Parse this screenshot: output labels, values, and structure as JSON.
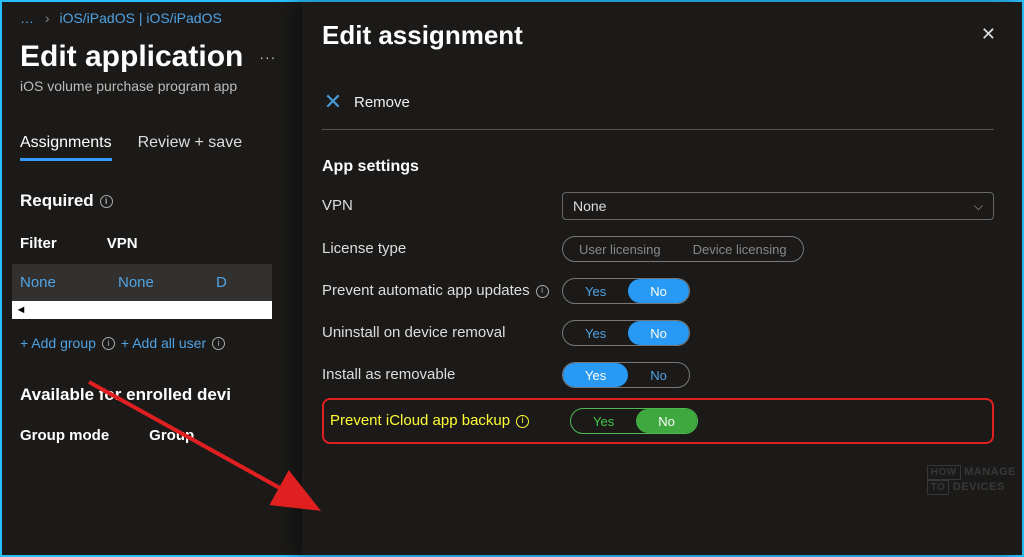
{
  "breadcrumb": {
    "dots": "…",
    "segment": "iOS/iPadOS | iOS/iPadOS"
  },
  "page": {
    "title": "Edit application",
    "subtitle": "iOS volume purchase program app"
  },
  "tabs": {
    "assignments": "Assignments",
    "review": "Review + save"
  },
  "required": {
    "header": "Required",
    "col_filter": "Filter",
    "col_vpn": "VPN",
    "val_filter": "None",
    "val_vpn": "None",
    "val_more": "D"
  },
  "links": {
    "add_group": "+ Add group",
    "add_all": "+ Add all user"
  },
  "available": {
    "header": "Available for enrolled devi",
    "col1": "Group mode",
    "col2": "Group"
  },
  "panel": {
    "title": "Edit assignment",
    "remove": "Remove",
    "settings_hdr": "App settings",
    "vpn_label": "VPN",
    "vpn_value": "None",
    "license_label": "License type",
    "license_opt1": "User licensing",
    "license_opt2": "Device licensing",
    "prevent_updates": "Prevent automatic app updates",
    "uninstall": "Uninstall on device removal",
    "install_removable": "Install as removable",
    "prevent_icloud": "Prevent iCloud app backup",
    "yes": "Yes",
    "no": "No"
  },
  "watermark": {
    "l1": "HOW",
    "l2": "MANAGE",
    "l3": "TO",
    "l4": "DEVICES"
  }
}
